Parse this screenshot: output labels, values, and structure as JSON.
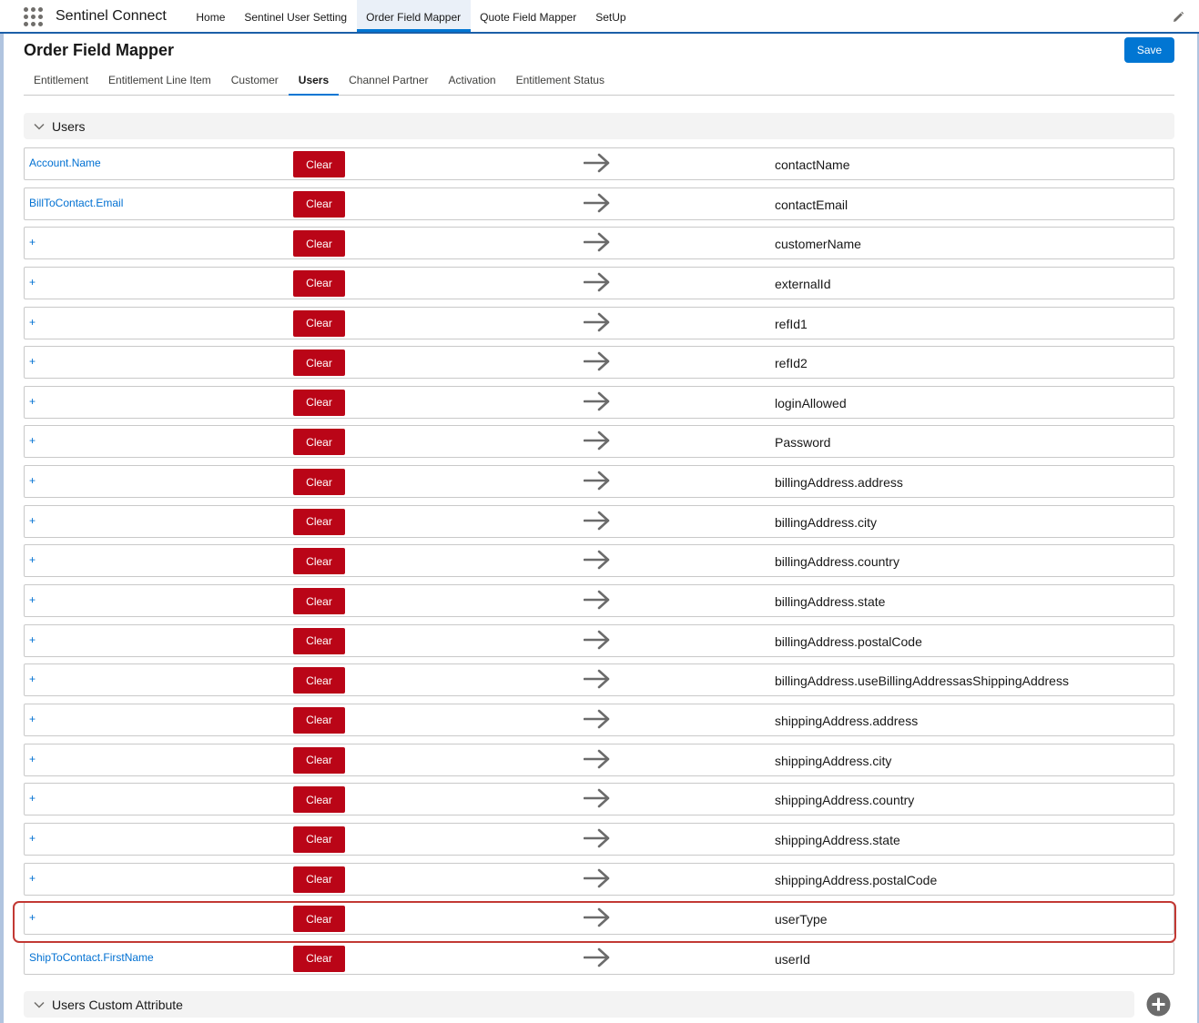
{
  "nav": {
    "app_name": "Sentinel Connect",
    "items": [
      {
        "label": "Home",
        "active": false
      },
      {
        "label": "Sentinel User Setting",
        "active": false
      },
      {
        "label": "Order Field Mapper",
        "active": true
      },
      {
        "label": "Quote Field Mapper",
        "active": false
      },
      {
        "label": "SetUp",
        "active": false
      }
    ]
  },
  "page": {
    "title": "Order Field Mapper",
    "save_label": "Save"
  },
  "tabs": [
    {
      "label": "Entitlement",
      "active": false
    },
    {
      "label": "Entitlement Line Item",
      "active": false
    },
    {
      "label": "Customer",
      "active": false
    },
    {
      "label": "Users",
      "active": true
    },
    {
      "label": "Channel Partner",
      "active": false
    },
    {
      "label": "Activation",
      "active": false
    },
    {
      "label": "Entitlement Status",
      "active": false
    }
  ],
  "users_section": {
    "title": "Users",
    "clear_label": "Clear",
    "rows": [
      {
        "source": "Account.Name",
        "target": "contactName"
      },
      {
        "source": "BillToContact.Email",
        "target": "contactEmail"
      },
      {
        "source": "+",
        "target": "customerName"
      },
      {
        "source": "+",
        "target": "externalId"
      },
      {
        "source": "+",
        "target": "refId1"
      },
      {
        "source": "+",
        "target": "refId2"
      },
      {
        "source": "+",
        "target": "loginAllowed"
      },
      {
        "source": "+",
        "target": "Password"
      },
      {
        "source": "+",
        "target": "billingAddress.address"
      },
      {
        "source": "+",
        "target": "billingAddress.city"
      },
      {
        "source": "+",
        "target": "billingAddress.country"
      },
      {
        "source": "+",
        "target": "billingAddress.state"
      },
      {
        "source": "+",
        "target": "billingAddress.postalCode"
      },
      {
        "source": "+",
        "target": "billingAddress.useBillingAddressasShippingAddress"
      },
      {
        "source": "+",
        "target": "shippingAddress.address"
      },
      {
        "source": "+",
        "target": "shippingAddress.city"
      },
      {
        "source": "+",
        "target": "shippingAddress.country"
      },
      {
        "source": "+",
        "target": "shippingAddress.state"
      },
      {
        "source": "+",
        "target": "shippingAddress.postalCode"
      },
      {
        "source": "+",
        "target": "userType"
      },
      {
        "source": "ShipToContact.FirstName",
        "target": "userId"
      }
    ]
  },
  "custom_section": {
    "title": "Users Custom Attribute"
  },
  "colors": {
    "brand": "#0176d3",
    "clear_button": "#ba0517",
    "link": "#0070d2",
    "highlight": "#c23934"
  },
  "icons": [
    "app-launcher-icon",
    "edit-pencil-icon",
    "chevron-down-icon",
    "arrow-right-icon",
    "add-circle-icon"
  ]
}
